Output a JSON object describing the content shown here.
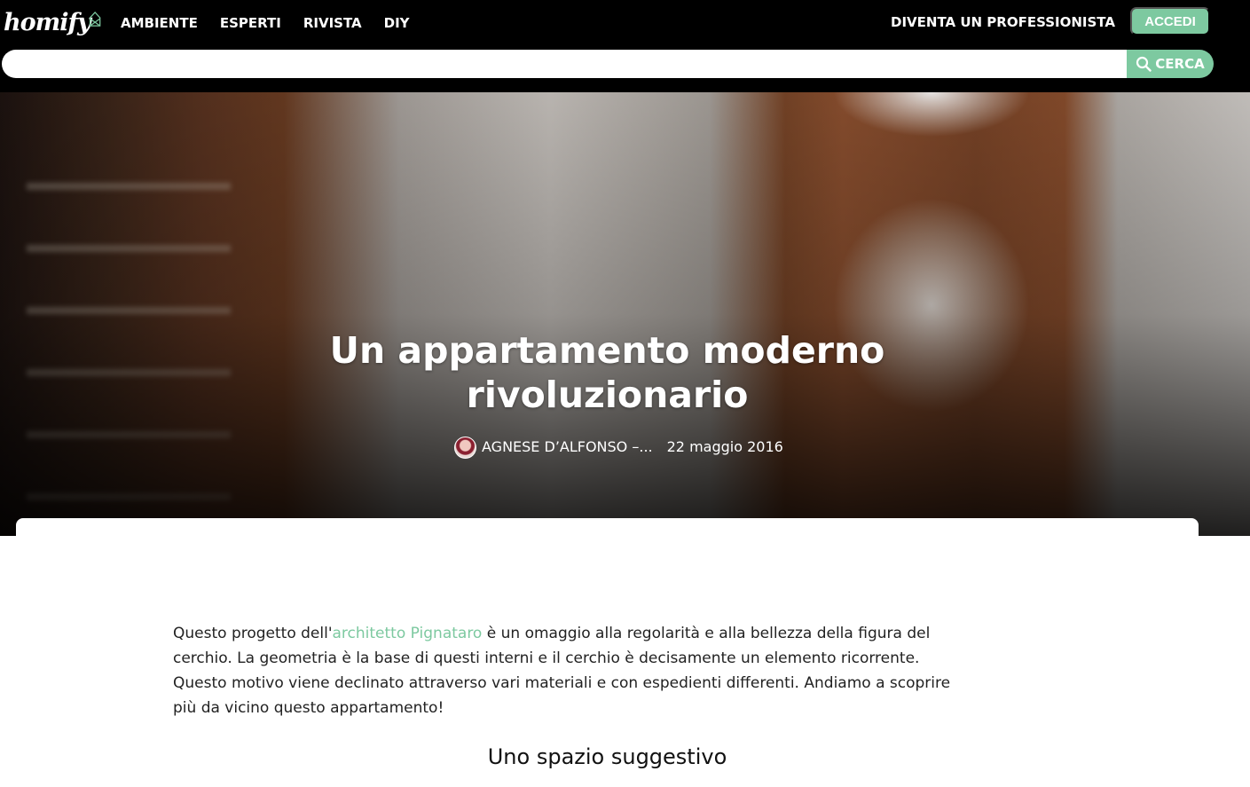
{
  "header": {
    "logo_text": "homify",
    "nav": [
      "AMBIENTE",
      "ESPERTI",
      "RIVISTA",
      "DIY"
    ],
    "become_pro": "DIVENTA UN PROFESSIONISTA",
    "login": "ACCEDI",
    "search": {
      "value": "",
      "placeholder": "",
      "button": "CERCA"
    }
  },
  "hero": {
    "title_line1": "Un appartamento moderno",
    "title_line2": "rivoluzionario",
    "author": "AGNESE D’ALFONSO –...",
    "date": "22 maggio 2016"
  },
  "article": {
    "intro_before_link": "Questo progetto dell'",
    "intro_link": "architetto Pignataro",
    "intro_after_link": " è un omaggio alla regolarità e alla bellezza della figura del cerchio. La geometria è la base di questi interni e il cerchio è decisamente un elemento ricorrente. Questo motivo viene declinato attraverso vari materiali e con espedienti differenti. Andiamo a scoprire più da vicino questo appartamento!",
    "section_heading": "Uno spazio suggestivo"
  },
  "colors": {
    "accent": "#7dc9a0",
    "header_bg": "#000000"
  },
  "icons": {
    "logo": "house-logo-icon",
    "search": "search-icon"
  }
}
